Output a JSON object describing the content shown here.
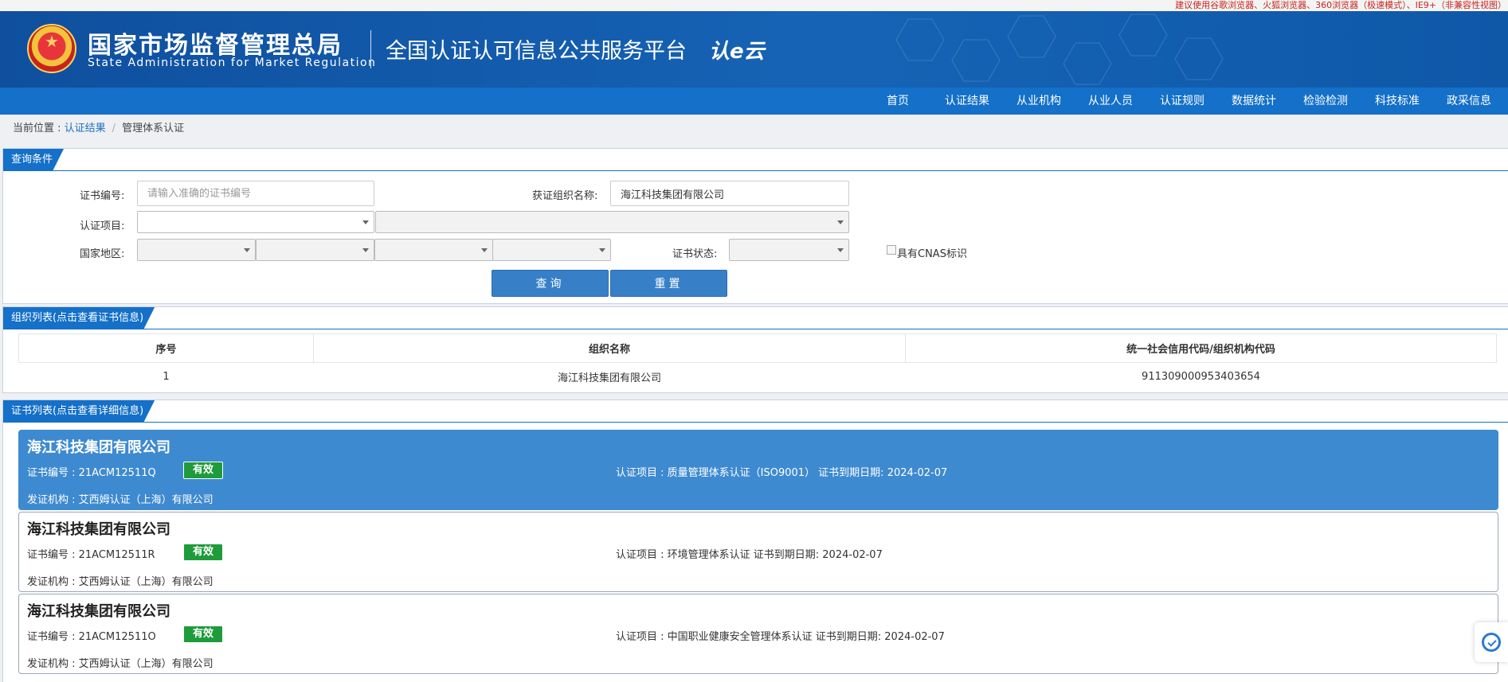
{
  "notice": "建议使用谷歌浏览器、火狐浏览器、360浏览器（极速模式）、IE9+（非兼容性视图）",
  "header": {
    "org_cn": "国家市场监督管理总局",
    "org_en": "State Administration  for  Market Regulation",
    "platform": "全国认证认可信息公共服务平台",
    "logo_mark": "认e云"
  },
  "nav": [
    "首页",
    "认证结果",
    "从业机构",
    "从业人员",
    "认证规则",
    "数据统计",
    "检验检测",
    "科技标准",
    "政采信息"
  ],
  "breadcrumb": {
    "prefix": "当前位置 : ",
    "link": "认证结果",
    "current": "管理体系认证"
  },
  "query": {
    "title": "查询条件",
    "cert_no_label": "证书编号:",
    "cert_no_placeholder": "请输入准确的证书编号",
    "org_name_label": "获证组织名称:",
    "org_name_value": "海江科技集团有限公司",
    "project_label": "认证项目:",
    "region_label": "国家地区:",
    "status_label": "证书状态:",
    "cnas_label": "具有CNAS标识",
    "search_button": "查询",
    "reset_button": "重置"
  },
  "org_list": {
    "title": "组织列表(点击查看证书信息)",
    "columns": [
      "序号",
      "组织名称",
      "统一社会信用代码/组织机构代码"
    ],
    "rows": [
      {
        "index": "1",
        "name": "海江科技集团有限公司",
        "code": "911309000953403654"
      }
    ]
  },
  "cert_list": {
    "title": "证书列表(点击查看详细信息)",
    "items": [
      {
        "org": "海江科技集团有限公司",
        "cert_no": "证书编号 : 21ACM12511Q",
        "status": "有效",
        "project": "认证项目 : 质量管理体系认证（ISO9001）   证书到期日期: 2024-02-07",
        "issuer": "发证机构 : 艾西姆认证（上海）有限公司",
        "active": true
      },
      {
        "org": "海江科技集团有限公司",
        "cert_no": "证书编号 : 21ACM12511R",
        "status": "有效",
        "project": "认证项目 : 环境管理体系认证   证书到期日期: 2024-02-07",
        "issuer": "发证机构 : 艾西姆认证（上海）有限公司",
        "active": false
      },
      {
        "org": "海江科技集团有限公司",
        "cert_no": "证书编号 : 21ACM12511O",
        "status": "有效",
        "project": "认证项目 : 中国职业健康安全管理体系认证   证书到期日期: 2024-02-07",
        "issuer": "发证机构 : 艾西姆认证（上海）有限公司",
        "active": false
      }
    ]
  },
  "colors": {
    "header": "#1663b5",
    "navbar": "#1470c8",
    "active_card": "#3e8ad0",
    "valid_badge": "#1e9b3a",
    "notice_text": "#c8241b"
  }
}
